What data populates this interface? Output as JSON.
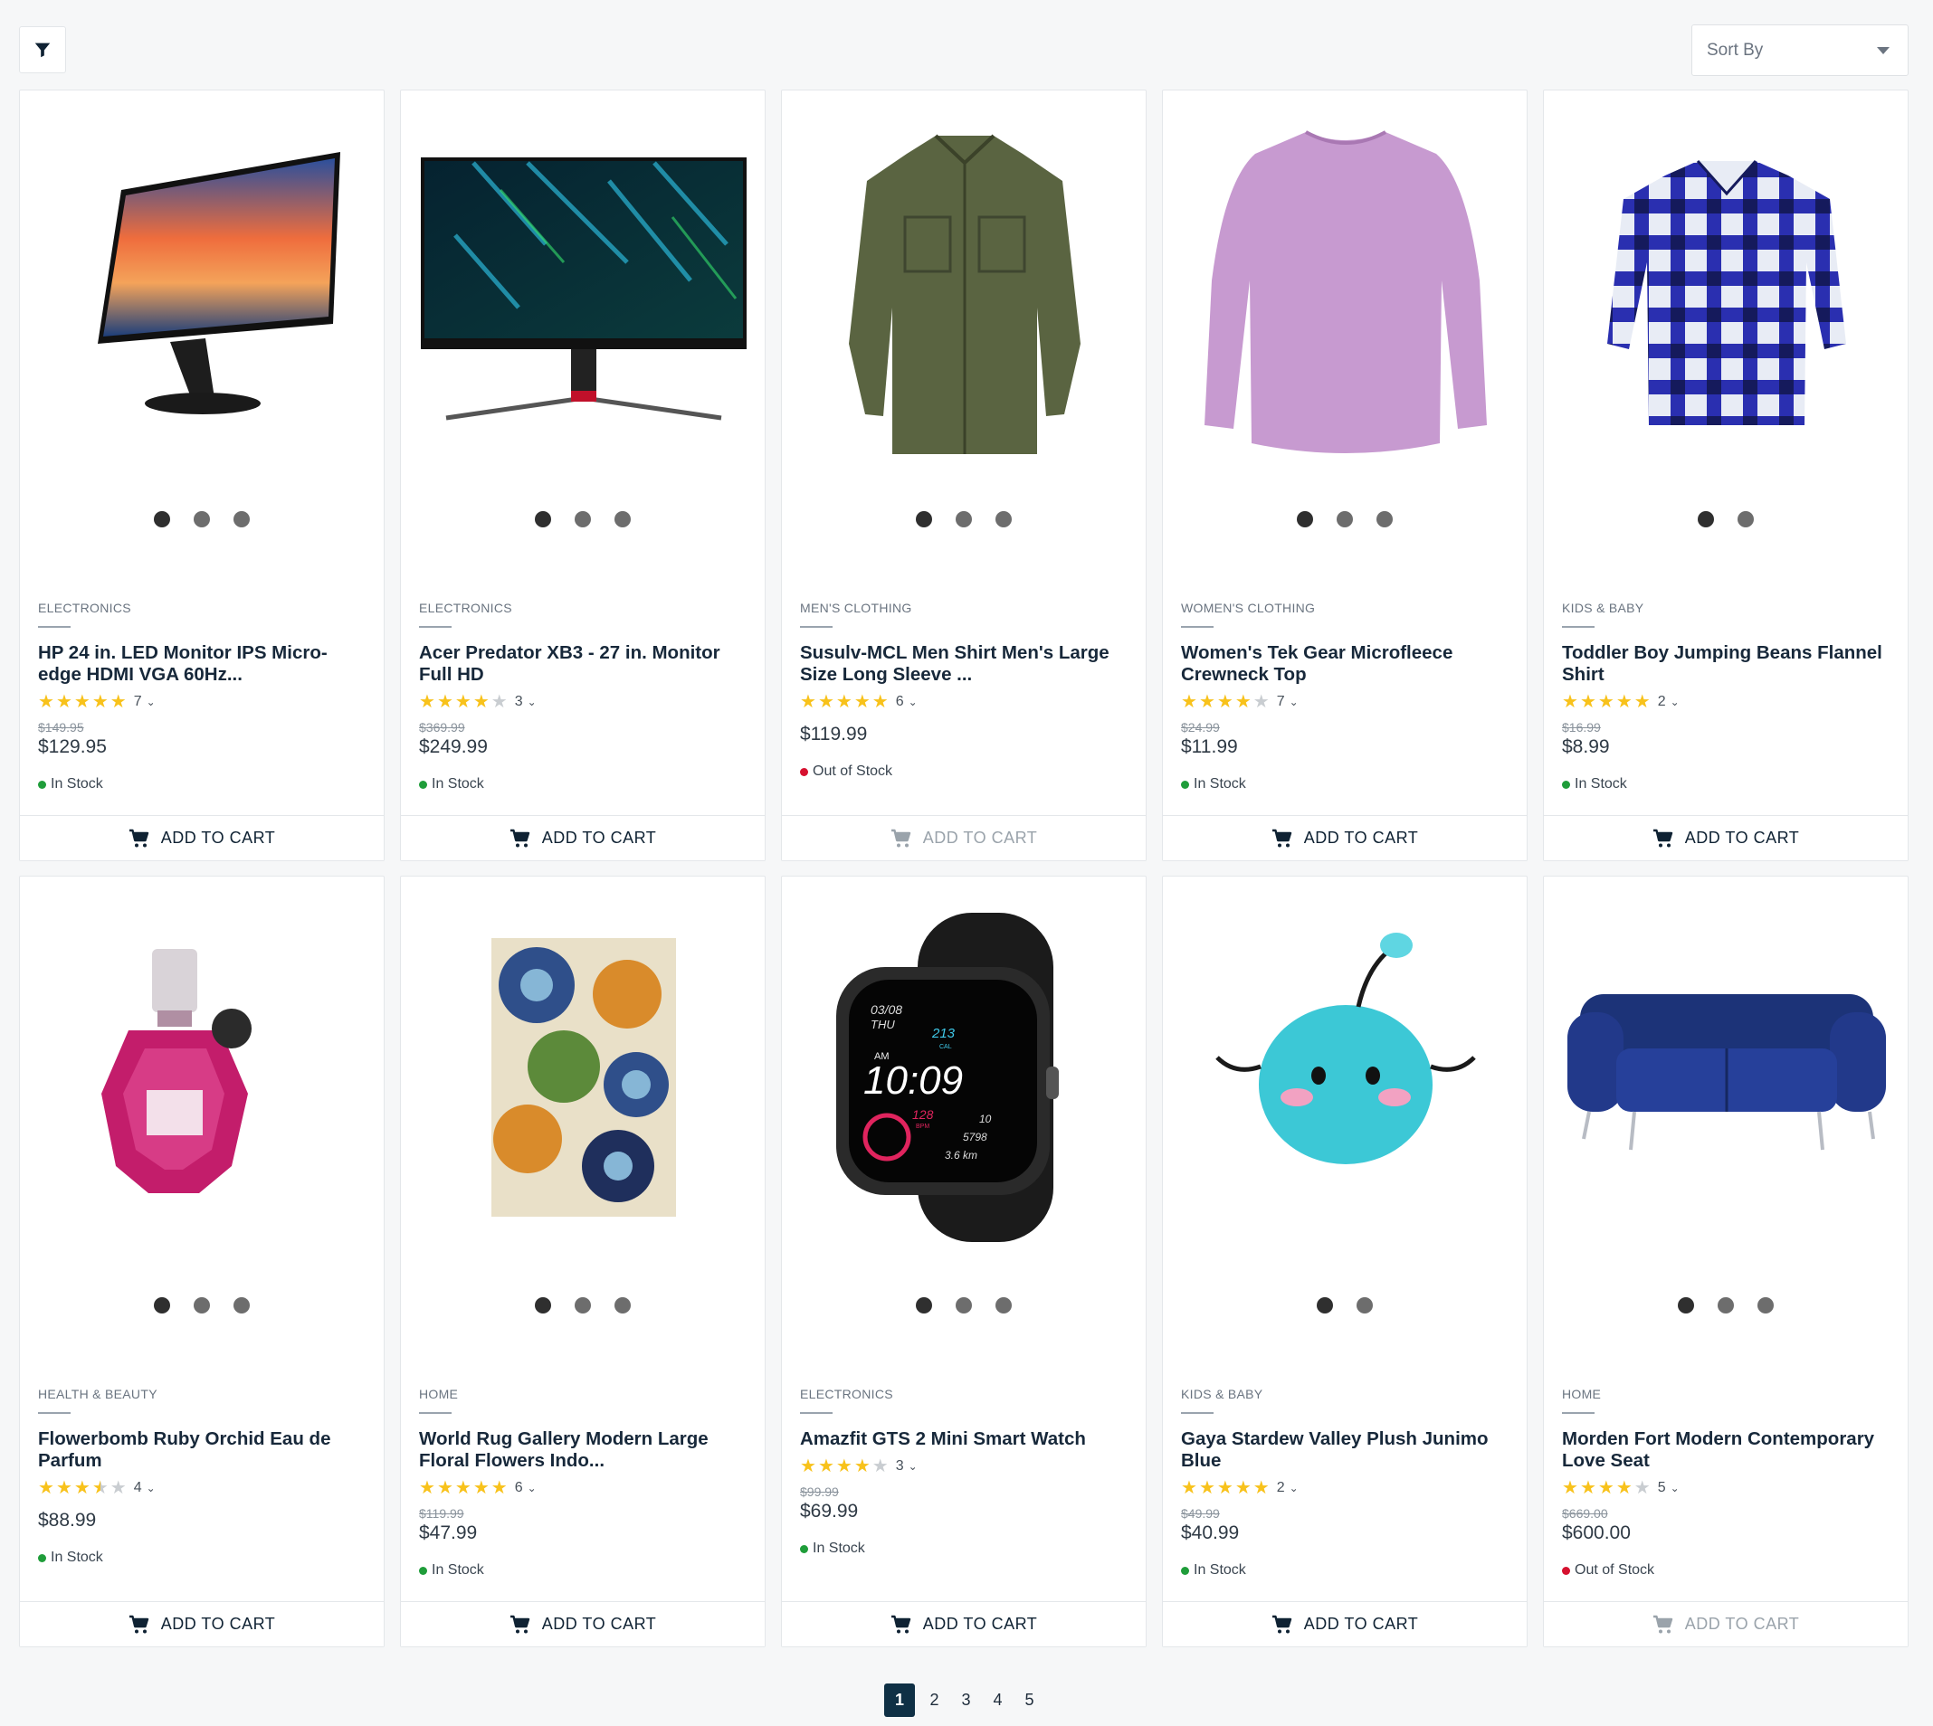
{
  "toolbar": {
    "sort_label": "Sort By"
  },
  "cart_label": "ADD TO CART",
  "products": [
    {
      "category": "ELECTRONICS",
      "title": "HP 24 in. LED Monitor IPS Micro-edge HDMI VGA 60Hz...",
      "rating": 5,
      "reviews": "7",
      "old_price": "$149.95",
      "price": "$129.95",
      "stock": "In Stock",
      "in_stock": true,
      "image_count": 3,
      "image": "monitor-sunset"
    },
    {
      "category": "ELECTRONICS",
      "title": "Acer Predator XB3 - 27 in. Monitor Full HD",
      "rating": 4,
      "reviews": "3",
      "old_price": "$369.99",
      "price": "$249.99",
      "stock": "In Stock",
      "in_stock": true,
      "image_count": 3,
      "image": "monitor-gaming"
    },
    {
      "category": "MEN'S CLOTHING",
      "title": "Susulv-MCL Men Shirt Men's Large Size Long Sleeve ...",
      "rating": 5,
      "reviews": "6",
      "old_price": "",
      "price": "$119.99",
      "stock": "Out of Stock",
      "in_stock": false,
      "image_count": 3,
      "image": "olive-shirt"
    },
    {
      "category": "WOMEN'S CLOTHING",
      "title": "Women's Tek Gear Microfleece Crewneck Top",
      "rating": 4,
      "reviews": "7",
      "old_price": "$24.99",
      "price": "$11.99",
      "stock": "In Stock",
      "in_stock": true,
      "image_count": 3,
      "image": "lilac-top"
    },
    {
      "category": "KIDS & BABY",
      "title": "Toddler Boy Jumping Beans Flannel Shirt",
      "rating": 5,
      "reviews": "2",
      "old_price": "$16.99",
      "price": "$8.99",
      "stock": "In Stock",
      "in_stock": true,
      "image_count": 2,
      "image": "plaid-shirt"
    },
    {
      "category": "HEALTH & BEAUTY",
      "title": "Flowerbomb Ruby Orchid Eau de Parfum",
      "rating": 3.5,
      "reviews": "4",
      "old_price": "",
      "price": "$88.99",
      "stock": "In Stock",
      "in_stock": true,
      "image_count": 3,
      "image": "perfume"
    },
    {
      "category": "HOME",
      "title": "World Rug Gallery Modern Large Floral Flowers Indo...",
      "rating": 5,
      "reviews": "6",
      "old_price": "$119.99",
      "price": "$47.99",
      "stock": "In Stock",
      "in_stock": true,
      "image_count": 3,
      "image": "rug"
    },
    {
      "category": "ELECTRONICS",
      "title": "Amazfit GTS 2 Mini Smart Watch",
      "rating": 4,
      "reviews": "3",
      "old_price": "$99.99",
      "price": "$69.99",
      "stock": "In Stock",
      "in_stock": true,
      "image_count": 3,
      "image": "smartwatch",
      "watch": {
        "date": "03/08",
        "day": "THU",
        "am": "AM",
        "time": "10:09",
        "cal": "213",
        "cal_unit": "CAL",
        "bpm": "128",
        "bpm_unit": "BPM",
        "steps": "5798",
        "dist": "3.6 km",
        "floors": "10"
      }
    },
    {
      "category": "KIDS & BABY",
      "title": "Gaya Stardew Valley Plush Junimo Blue",
      "rating": 5,
      "reviews": "2",
      "old_price": "$49.99",
      "price": "$40.99",
      "stock": "In Stock",
      "in_stock": true,
      "image_count": 2,
      "image": "plush"
    },
    {
      "category": "HOME",
      "title": "Morden Fort Modern Contemporary Love Seat",
      "rating": 4,
      "reviews": "5",
      "old_price": "$669.00",
      "price": "$600.00",
      "stock": "Out of Stock",
      "in_stock": false,
      "image_count": 3,
      "image": "sofa"
    }
  ],
  "pagination": {
    "pages": [
      "1",
      "2",
      "3",
      "4",
      "5"
    ],
    "current": "1"
  }
}
